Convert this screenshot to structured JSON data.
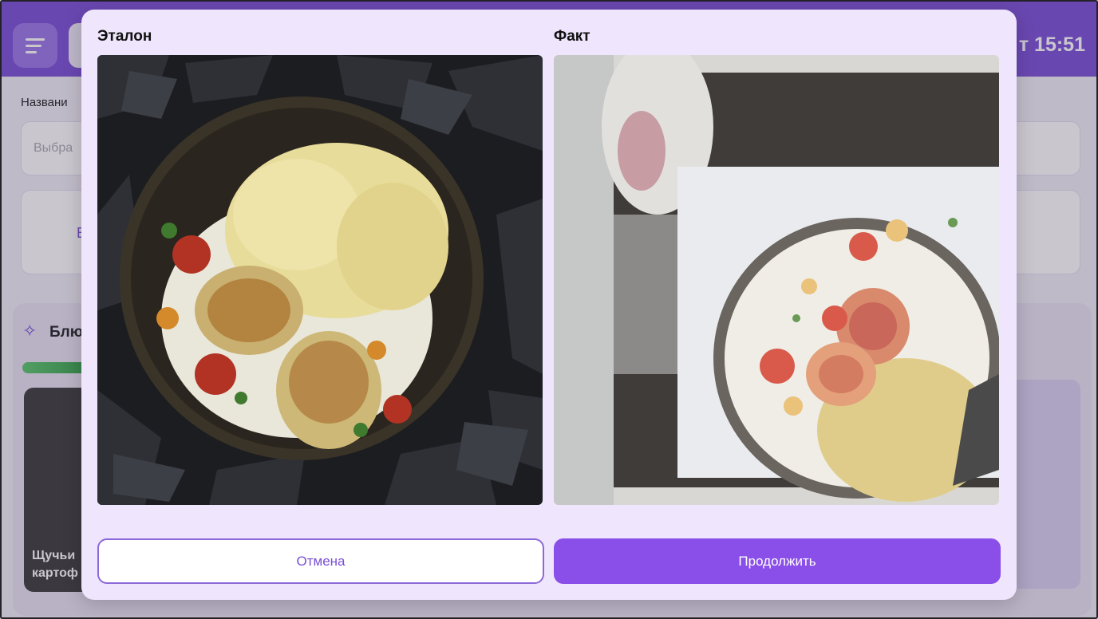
{
  "app": {
    "time_partial": "т 15:51",
    "label_partial": "Названи",
    "placeholder_partial": "Выбра",
    "field_letter": "В",
    "section_title_partial": "Блю",
    "card_title_partial": "Щучьи\nкартоф"
  },
  "modal": {
    "reference_title": "Эталон",
    "actual_title": "Факт",
    "cancel_label": "Отмена",
    "continue_label": "Продолжить"
  },
  "icons": {
    "menu": "menu-icon",
    "sparkle": "sparkle-icon"
  },
  "colors": {
    "accent": "#7a4fd6",
    "button_primary": "#8a4fe8",
    "modal_bg": "#efe5fc"
  }
}
